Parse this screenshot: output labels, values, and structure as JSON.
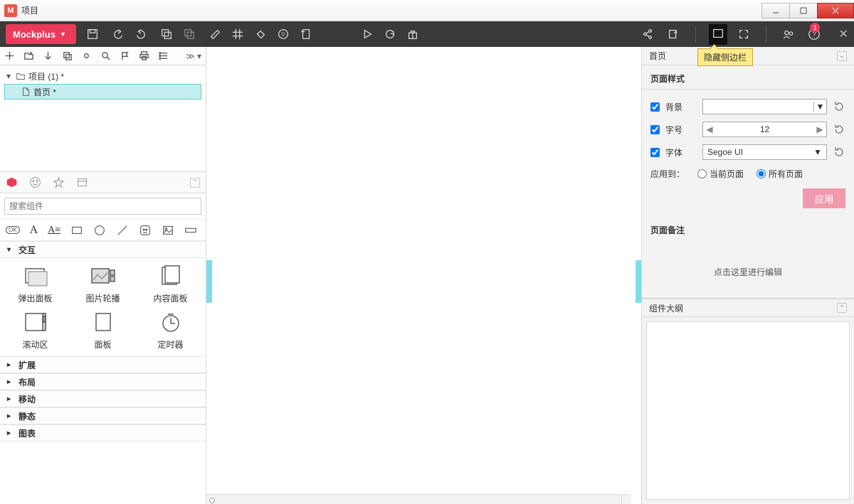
{
  "window": {
    "title": "项目"
  },
  "brand": "Mockplus",
  "notification_count": "1",
  "tooltip": "隐藏侧边栏",
  "tree": {
    "root": "项目 (1)  *",
    "page": "首页  *"
  },
  "search_placeholder": "搜索组件",
  "categories": {
    "interact": "交互",
    "items": [
      {
        "label": "弹出面板"
      },
      {
        "label": "图片轮播"
      },
      {
        "label": "内容面板"
      },
      {
        "label": "滚动区"
      },
      {
        "label": "面板"
      },
      {
        "label": "定时器"
      }
    ],
    "collapsed": [
      "扩展",
      "布局",
      "移动",
      "静态",
      "图表"
    ]
  },
  "right": {
    "header": "首页",
    "section_style": "页面样式",
    "bg": "背景",
    "fontsize": "字号",
    "fontsize_val": "12",
    "font": "字体",
    "font_val": "Segoe UI",
    "apply_to": "应用到：",
    "current": "当前页面",
    "all": "所有页面",
    "apply_btn": "应用",
    "notes_title": "页面备注",
    "notes_hint": "点击这里进行编辑",
    "outline_title": "组件大纲"
  }
}
